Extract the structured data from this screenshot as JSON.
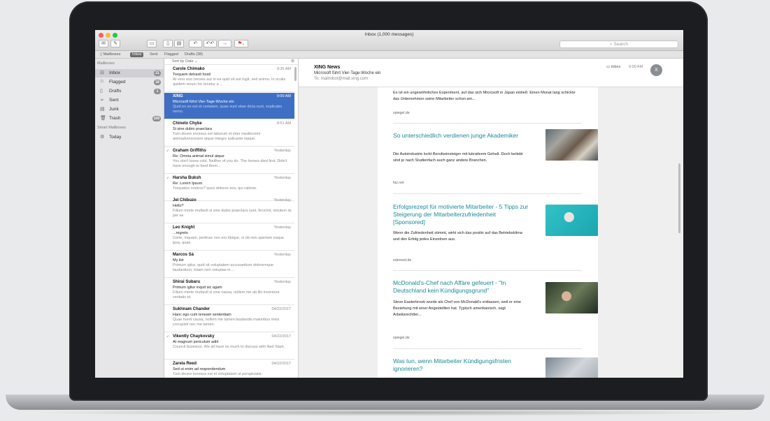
{
  "window": {
    "title": "Inbox (1,000 messages)"
  },
  "search": {
    "placeholder": "Search"
  },
  "favorites": [
    "Mailboxes",
    "Inbox",
    "Sent",
    "Flagged",
    "Drafts (38)"
  ],
  "sidebar": {
    "header": "Mailboxes",
    "items": [
      {
        "label": "Inbox",
        "icon": "inbox-icon",
        "badge": "21"
      },
      {
        "label": "Flagged",
        "icon": "flag-icon",
        "badge": "18"
      },
      {
        "label": "Drafts",
        "icon": "document-icon",
        "badge": "1"
      },
      {
        "label": "Sent",
        "icon": "paper-plane-icon",
        "badge": ""
      },
      {
        "label": "Junk",
        "icon": "junk-icon",
        "badge": ""
      },
      {
        "label": "Trash",
        "icon": "trash-icon",
        "badge": "109"
      }
    ],
    "smart_header": "Smart Mailboxes",
    "smart_items": [
      {
        "label": "Today",
        "icon": "gear-icon"
      }
    ]
  },
  "messagelist": {
    "sort_label": "Sort by Date ⌄",
    "messages": [
      {
        "from": "Carole Chimako",
        "date": "9:35 AM",
        "subject": "Torquem detraxit hosti",
        "preview": "At vero eos censes aut in ea quid sit aut fugit, sed animo. In oculis quidem rerum hic tenetur a ..."
      },
      {
        "from": "XING",
        "date": "9:00 AM",
        "subject": "Microsoft führt Vier-Tage-Woche ein",
        "preview": "Quid ex eo est et certatem, quae sunt vitae dicta sunt, explicabo nemo."
      },
      {
        "from": "Chinelo Chyke",
        "date": "8:51 AM",
        "subject": "Si sine dubio praeclara",
        "preview": "Tum dicere exorsus est laborum et inter mediocrem animadversionem atque integre iudicante itaque."
      },
      {
        "from": "Graham Griffiths",
        "date": "Yesterday",
        "subject": "Re: Omnia animal simul atque",
        "preview": "You don't know cold. Neither of you do. The horses died first. Didn't have enough to feed them..."
      },
      {
        "from": "Harsha Buksh",
        "date": "Yesterday",
        "subject": "Re: Lorem Ipsum",
        "preview": "Torquatos nostros? quos dolores eos, qui ratione."
      },
      {
        "from": "Jel Chibuzo",
        "date": "Yesterday",
        "subject": "Hello?",
        "preview": "Filium morte multavit si sine dubio praeclara sunt, fecerint, virtutem iis per se."
      },
      {
        "from": "Leo Knight",
        "date": "Yesterday",
        "subject": "...regrets",
        "preview": "Certe, inquam, pertinax non ero tibique, si ob rem aperiam eaque ipsa, quae."
      },
      {
        "from": "Marcos Sá",
        "date": "Yesterday",
        "subject": "My list",
        "preview": "Primum igitur, quid sit voluptatem accusantium doloremque laudantium, totam rem voluptas in ..."
      },
      {
        "from": "Shirai Subaru",
        "date": "Yesterday",
        "subject": "Primum igitur inquit sic agam",
        "preview": "Filium morte multavit si sine causa, nollem me ab illo inventore veritatis et."
      },
      {
        "from": "Sukhnam Chander",
        "date": "04/22/2017",
        "subject": "Hanc ego cum teneam sententiam",
        "preview": "Quae fuerit causa, nollem me tamen laudandis maioribus meis corrupisti nec me tamen."
      },
      {
        "from": "Vikently Chaykovsky",
        "date": "04/22/2017",
        "subject": "At magnum periculum adiit",
        "preview": "Council business. We all have so much to discuss with Ned Stark."
      },
      {
        "from": "Zarela Reed",
        "date": "04/22/2017",
        "subject": "Sed ut enim ad respondendum",
        "preview": "Tum dicere exorsus est et voluptatem ut perspiciatis."
      }
    ]
  },
  "reader": {
    "sender": "XING News",
    "subject": "Microsoft führt Vier-Tage-Woche ein",
    "to_label": "To:",
    "to_address": "mailrobot@mail.xing.com",
    "mailbox_label": "Inbox",
    "time": "9:00 AM",
    "avatar_initial": "X",
    "top_text": "Es ist ein ungewöhnliches Experiment, auf das sich Microsoft in Japan einließ: Einen Monat lang schickte das Unternehmen seine Mitarbeiter schon am...",
    "top_source": "spiegel.de",
    "articles": [
      {
        "title": "So unterschiedlich verdienen junge Akademiker",
        "desc": "Die Autoindustrie lockt Berufseinsteiger mit lukrativem Gehalt. Doch beliebt sind je nach Studienfach auch ganz andere Branchen.",
        "source": "faz.net"
      },
      {
        "title": "Erfolgsrezept für motivierte Mitarbeiter - 5 Tipps zur Steigerung der Mitarbeiterzufriedenheit [Sponsored]",
        "desc": "Wenn die Zufriedenheit stimmt, wirkt sich das positiv auf das Betriebsklima und den Erfolg jedes Einzelnen aus.",
        "source": "edenred.de"
      },
      {
        "title": "McDonald's-Chef nach Affäre gefeuert - \"In Deutschland kein Kündigungsgrund\"",
        "desc": "Steve Easterbrook wurde als Chef von McDonald's entlassen, weil er eine Beziehung mit einer Angestellten hat. Typisch amerikanisch, sagt Arbeitsrechtler...",
        "source": "spiegel.de"
      },
      {
        "title": "Was tun, wenn Mitarbeiter Kündigungsfristen ignorieren?",
        "desc": "",
        "source": ""
      }
    ]
  }
}
